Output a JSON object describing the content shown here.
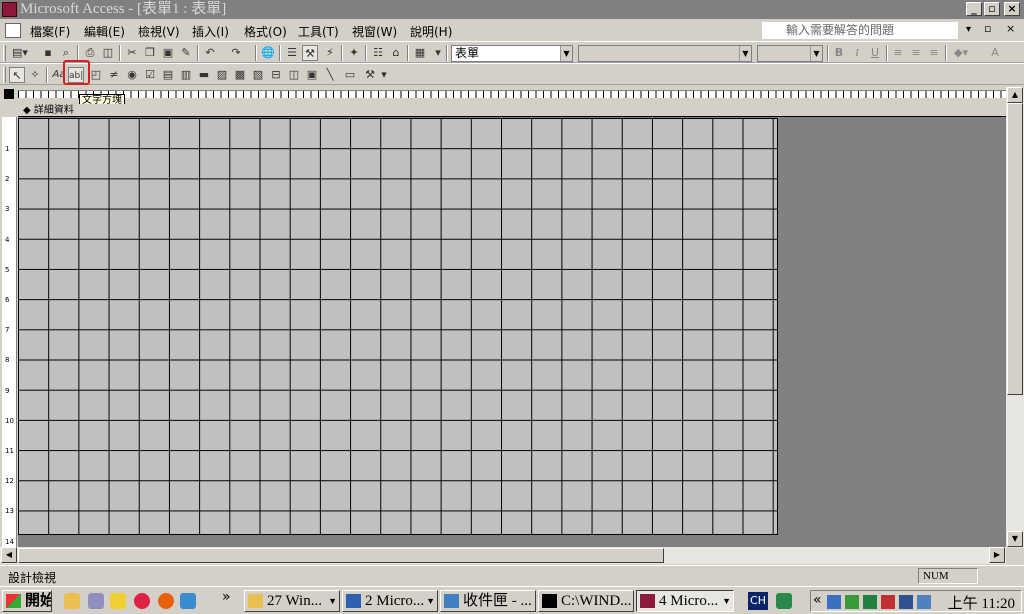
{
  "window": {
    "title": "Microsoft Access - [表單1 : 表單]",
    "ask_question": "輸入需要解答的問題",
    "controls": [
      "_",
      "▫",
      "×"
    ]
  },
  "menu": {
    "items": [
      "檔案(F)",
      "編輯(E)",
      "檢視(V)",
      "插入(I)",
      "格式(O)",
      "工具(T)",
      "視窗(W)",
      "說明(H)"
    ]
  },
  "formatting": {
    "object_combo": "表單",
    "bold": "B",
    "italic": "I",
    "underline": "U",
    "font_color": "A"
  },
  "toolbox": {
    "label_glyph": "Aa",
    "textbox_glyph": "ab|",
    "tooltip": "文字方塊"
  },
  "form": {
    "section": "◆ 詳細資料",
    "vruler_marks": [
      "1",
      "2",
      "3",
      "4",
      "5",
      "6",
      "7",
      "8",
      "9",
      "10",
      "11",
      "12",
      "13",
      "14"
    ]
  },
  "statusbar": {
    "mode": "設計檢視",
    "num": "NUM"
  },
  "taskbar": {
    "start": "開始",
    "more": "»",
    "buttons": [
      {
        "label": "27 Win...",
        "icon": "folder-icon"
      },
      {
        "label": "2 Micro...",
        "icon": "word-icon"
      },
      {
        "label": "收件匣 - ...",
        "icon": "outlook-icon"
      },
      {
        "label": "C:\\WIND...",
        "icon": "console-icon"
      },
      {
        "label": "4 Micro...",
        "icon": "access-icon"
      }
    ],
    "ime": "CH",
    "clock": "上午 11:20"
  }
}
